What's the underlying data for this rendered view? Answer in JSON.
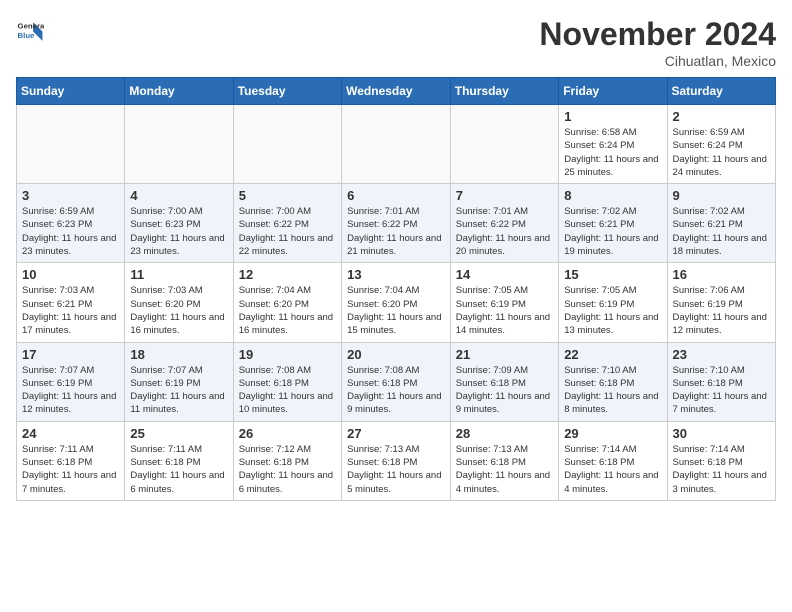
{
  "header": {
    "logo_line1": "General",
    "logo_line2": "Blue",
    "month": "November 2024",
    "location": "Cihuatlan, Mexico"
  },
  "weekdays": [
    "Sunday",
    "Monday",
    "Tuesday",
    "Wednesday",
    "Thursday",
    "Friday",
    "Saturday"
  ],
  "weeks": [
    {
      "even": false,
      "days": [
        {
          "num": "",
          "info": ""
        },
        {
          "num": "",
          "info": ""
        },
        {
          "num": "",
          "info": ""
        },
        {
          "num": "",
          "info": ""
        },
        {
          "num": "",
          "info": ""
        },
        {
          "num": "1",
          "info": "Sunrise: 6:58 AM\nSunset: 6:24 PM\nDaylight: 11 hours\nand 25 minutes."
        },
        {
          "num": "2",
          "info": "Sunrise: 6:59 AM\nSunset: 6:24 PM\nDaylight: 11 hours\nand 24 minutes."
        }
      ]
    },
    {
      "even": true,
      "days": [
        {
          "num": "3",
          "info": "Sunrise: 6:59 AM\nSunset: 6:23 PM\nDaylight: 11 hours\nand 23 minutes."
        },
        {
          "num": "4",
          "info": "Sunrise: 7:00 AM\nSunset: 6:23 PM\nDaylight: 11 hours\nand 23 minutes."
        },
        {
          "num": "5",
          "info": "Sunrise: 7:00 AM\nSunset: 6:22 PM\nDaylight: 11 hours\nand 22 minutes."
        },
        {
          "num": "6",
          "info": "Sunrise: 7:01 AM\nSunset: 6:22 PM\nDaylight: 11 hours\nand 21 minutes."
        },
        {
          "num": "7",
          "info": "Sunrise: 7:01 AM\nSunset: 6:22 PM\nDaylight: 11 hours\nand 20 minutes."
        },
        {
          "num": "8",
          "info": "Sunrise: 7:02 AM\nSunset: 6:21 PM\nDaylight: 11 hours\nand 19 minutes."
        },
        {
          "num": "9",
          "info": "Sunrise: 7:02 AM\nSunset: 6:21 PM\nDaylight: 11 hours\nand 18 minutes."
        }
      ]
    },
    {
      "even": false,
      "days": [
        {
          "num": "10",
          "info": "Sunrise: 7:03 AM\nSunset: 6:21 PM\nDaylight: 11 hours\nand 17 minutes."
        },
        {
          "num": "11",
          "info": "Sunrise: 7:03 AM\nSunset: 6:20 PM\nDaylight: 11 hours\nand 16 minutes."
        },
        {
          "num": "12",
          "info": "Sunrise: 7:04 AM\nSunset: 6:20 PM\nDaylight: 11 hours\nand 16 minutes."
        },
        {
          "num": "13",
          "info": "Sunrise: 7:04 AM\nSunset: 6:20 PM\nDaylight: 11 hours\nand 15 minutes."
        },
        {
          "num": "14",
          "info": "Sunrise: 7:05 AM\nSunset: 6:19 PM\nDaylight: 11 hours\nand 14 minutes."
        },
        {
          "num": "15",
          "info": "Sunrise: 7:05 AM\nSunset: 6:19 PM\nDaylight: 11 hours\nand 13 minutes."
        },
        {
          "num": "16",
          "info": "Sunrise: 7:06 AM\nSunset: 6:19 PM\nDaylight: 11 hours\nand 12 minutes."
        }
      ]
    },
    {
      "even": true,
      "days": [
        {
          "num": "17",
          "info": "Sunrise: 7:07 AM\nSunset: 6:19 PM\nDaylight: 11 hours\nand 12 minutes."
        },
        {
          "num": "18",
          "info": "Sunrise: 7:07 AM\nSunset: 6:19 PM\nDaylight: 11 hours\nand 11 minutes."
        },
        {
          "num": "19",
          "info": "Sunrise: 7:08 AM\nSunset: 6:18 PM\nDaylight: 11 hours\nand 10 minutes."
        },
        {
          "num": "20",
          "info": "Sunrise: 7:08 AM\nSunset: 6:18 PM\nDaylight: 11 hours\nand 9 minutes."
        },
        {
          "num": "21",
          "info": "Sunrise: 7:09 AM\nSunset: 6:18 PM\nDaylight: 11 hours\nand 9 minutes."
        },
        {
          "num": "22",
          "info": "Sunrise: 7:10 AM\nSunset: 6:18 PM\nDaylight: 11 hours\nand 8 minutes."
        },
        {
          "num": "23",
          "info": "Sunrise: 7:10 AM\nSunset: 6:18 PM\nDaylight: 11 hours\nand 7 minutes."
        }
      ]
    },
    {
      "even": false,
      "days": [
        {
          "num": "24",
          "info": "Sunrise: 7:11 AM\nSunset: 6:18 PM\nDaylight: 11 hours\nand 7 minutes."
        },
        {
          "num": "25",
          "info": "Sunrise: 7:11 AM\nSunset: 6:18 PM\nDaylight: 11 hours\nand 6 minutes."
        },
        {
          "num": "26",
          "info": "Sunrise: 7:12 AM\nSunset: 6:18 PM\nDaylight: 11 hours\nand 6 minutes."
        },
        {
          "num": "27",
          "info": "Sunrise: 7:13 AM\nSunset: 6:18 PM\nDaylight: 11 hours\nand 5 minutes."
        },
        {
          "num": "28",
          "info": "Sunrise: 7:13 AM\nSunset: 6:18 PM\nDaylight: 11 hours\nand 4 minutes."
        },
        {
          "num": "29",
          "info": "Sunrise: 7:14 AM\nSunset: 6:18 PM\nDaylight: 11 hours\nand 4 minutes."
        },
        {
          "num": "30",
          "info": "Sunrise: 7:14 AM\nSunset: 6:18 PM\nDaylight: 11 hours\nand 3 minutes."
        }
      ]
    }
  ]
}
